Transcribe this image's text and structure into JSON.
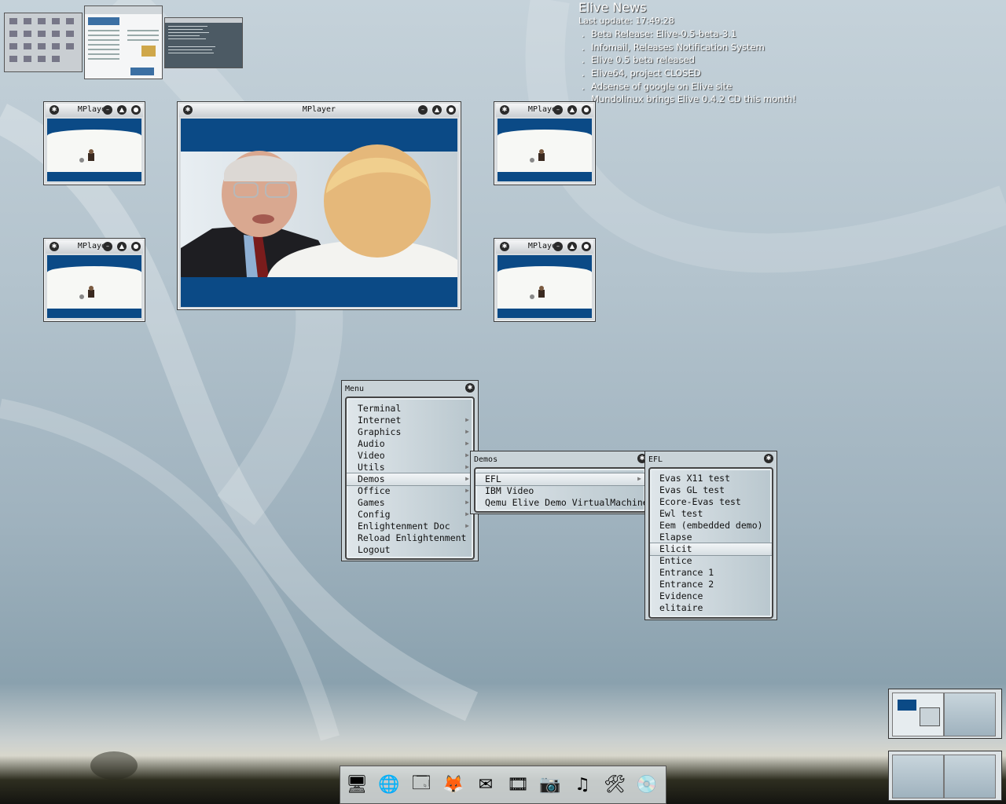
{
  "news": {
    "title": "Elive News",
    "updated": "Last update: 17:49:28",
    "items": [
      "Beta Release: Elive-0.5-beta-3.1",
      "Infomail, Releases Notification System",
      "Elive 0.5 beta released",
      "Elive64, project CLOSED",
      "Adsense of google on Elive site",
      "Mundolinux brings Elive 0.4.2 CD this month!"
    ]
  },
  "mplayer_windows": {
    "title": "MPlayer"
  },
  "main_menu": {
    "title": "Menu",
    "items": [
      "Terminal",
      "Internet",
      "Graphics",
      "Audio",
      "Video",
      "Utils",
      "Demos",
      "Office",
      "Games",
      "Config",
      "Enlightenment Doc",
      "Reload Enlightenment",
      "Logout"
    ],
    "submenu_flags": [
      false,
      true,
      true,
      true,
      true,
      true,
      true,
      true,
      true,
      true,
      true,
      false,
      false
    ],
    "selected": "Demos"
  },
  "demos_menu": {
    "title": "Demos",
    "items": [
      "EFL",
      "IBM Video",
      "Qemu Elive Demo VirtualMachine"
    ],
    "selected": "EFL"
  },
  "efl_menu": {
    "title": "EFL",
    "items": [
      "Evas X11 test",
      "Evas GL test",
      "Ecore-Evas test",
      "Ewl test",
      "Eem (embedded demo)",
      "Elapse",
      "Elicit",
      "Entice",
      "Entrance 1",
      "Entrance 2",
      "Evidence",
      "elitaire"
    ],
    "selected": "Elicit"
  },
  "dock": {
    "icons": [
      "computer-icon",
      "network-icon",
      "file-manager-icon",
      "firefox-icon",
      "thunderbird-icon",
      "video-icon",
      "camera-icon",
      "music-icon",
      "tools-icon",
      "elive-cd-icon"
    ]
  },
  "colors": {
    "video_blue": "#0b4a86",
    "menu_bg": "#c9d3d8"
  }
}
